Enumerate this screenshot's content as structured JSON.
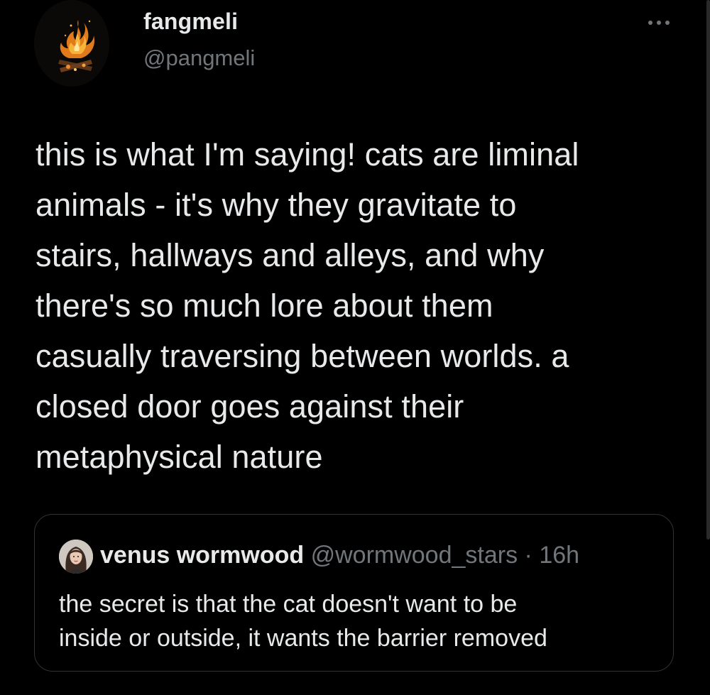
{
  "tweet": {
    "author": {
      "display_name": "fangmeli",
      "handle": "@pangmeli",
      "avatar_icon": "campfire-icon"
    },
    "more_icon": "more-options-icon",
    "text": "this is what I'm saying! cats are liminal\nanimals - it's why they gravitate to\nstairs, hallways and alleys, and why\nthere's so much lore about them\ncasually traversing between worlds. a\nclosed door goes against their\nmetaphysical nature"
  },
  "quote": {
    "author": {
      "display_name": "venus wormwood",
      "handle": "@wormwood_stars",
      "separator": "·",
      "time": "16h",
      "avatar_icon": "portrait-avatar-icon"
    },
    "text": "the secret is that the cat doesn't want to be\ninside or outside, it wants the barrier removed"
  },
  "colors": {
    "background": "#000000",
    "primary_text": "#e7e9ea",
    "secondary_text": "#71767b",
    "border": "#2f3336"
  }
}
